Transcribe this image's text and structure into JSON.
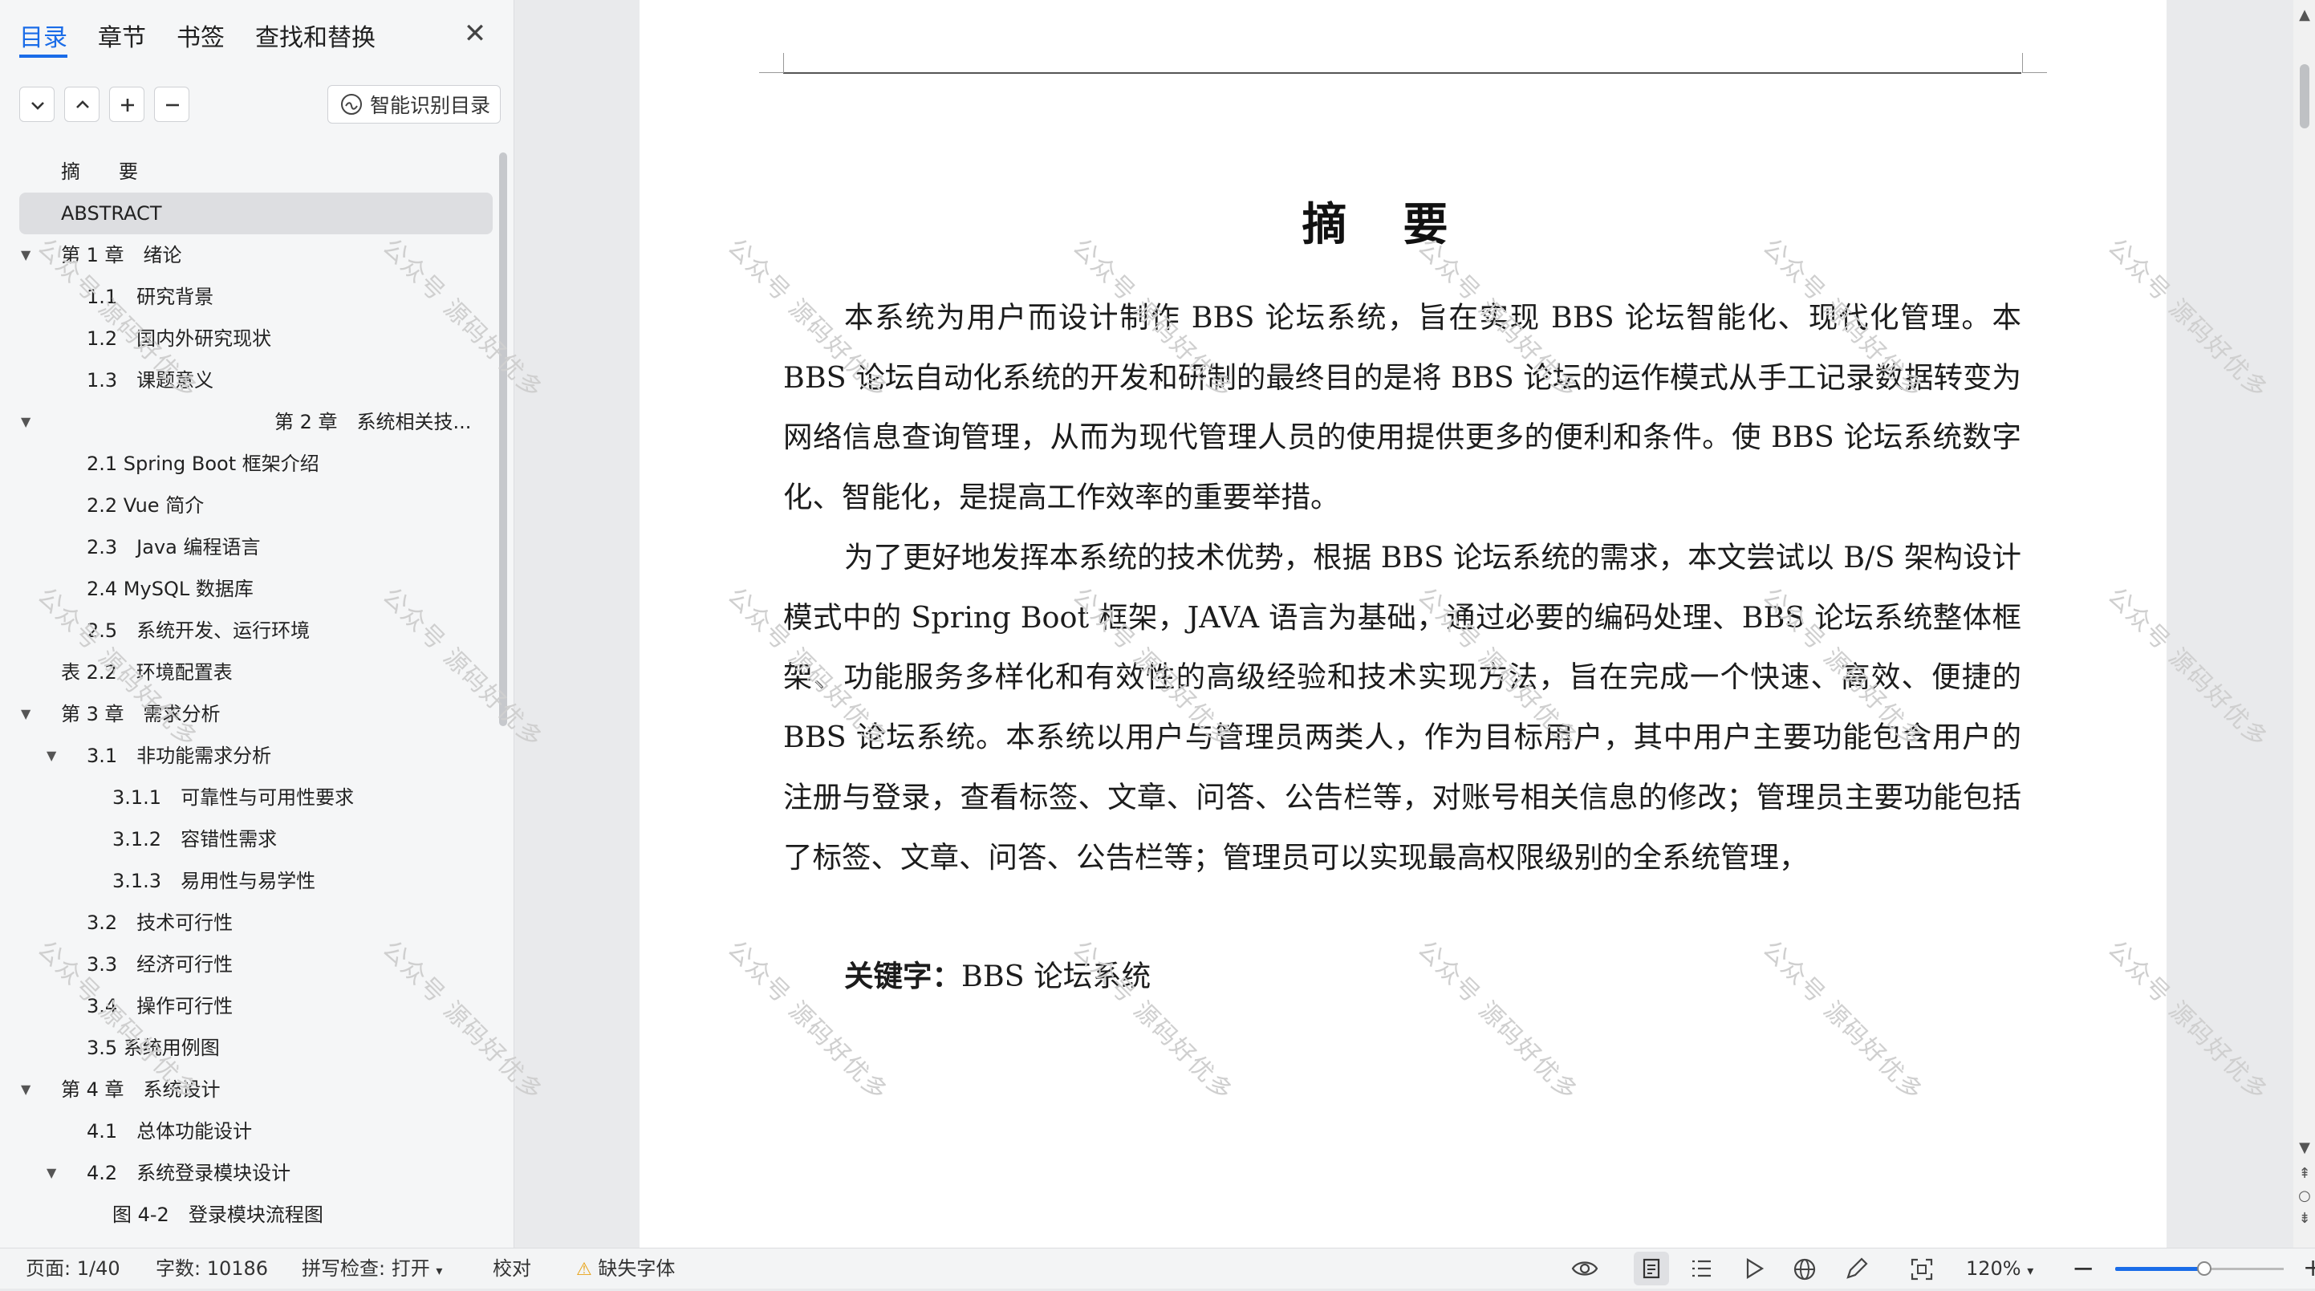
{
  "nav": {
    "tabs": [
      {
        "label": "目录",
        "active": true
      },
      {
        "label": "章节",
        "active": false
      },
      {
        "label": "书签",
        "active": false
      },
      {
        "label": "查找和替换",
        "active": false
      }
    ],
    "close_icon": "close-icon",
    "smart_button_label": "智能识别目录",
    "toc": [
      {
        "label": "摘　　要",
        "level": 1,
        "arrow": ""
      },
      {
        "label": "ABSTRACT",
        "level": 1,
        "arrow": "",
        "selected": true
      },
      {
        "label": "第 1 章　绪论",
        "level": 1,
        "arrow": "▼"
      },
      {
        "label": "1.1　研究背景",
        "level": 2,
        "arrow": ""
      },
      {
        "label": "1.2　国内外研究现状",
        "level": 2,
        "arrow": ""
      },
      {
        "label": "1.3　课题意义",
        "level": 2,
        "arrow": ""
      },
      {
        "label": "第 2 章　系统相关技...",
        "level": 0,
        "arrow": "▼"
      },
      {
        "label": "2.1 Spring Boot 框架介绍",
        "level": 2,
        "arrow": ""
      },
      {
        "label": "2.2 Vue 简介",
        "level": 2,
        "arrow": ""
      },
      {
        "label": "2.3　Java 编程语言",
        "level": 2,
        "arrow": ""
      },
      {
        "label": "2.4 MySQL 数据库",
        "level": 2,
        "arrow": ""
      },
      {
        "label": "2.5　系统开发、运行环境",
        "level": 2,
        "arrow": ""
      },
      {
        "label": "表 2.2　环境配置表",
        "level": 1,
        "arrow": ""
      },
      {
        "label": "第 3 章　需求分析",
        "level": 1,
        "arrow": "▼"
      },
      {
        "label": "3.1　非功能需求分析",
        "level": 2,
        "arrow": "▼"
      },
      {
        "label": "3.1.1　可靠性与可用性要求",
        "level": 3,
        "arrow": ""
      },
      {
        "label": "3.1.2　容错性需求",
        "level": 3,
        "arrow": ""
      },
      {
        "label": "3.1.3　易用性与易学性",
        "level": 3,
        "arrow": ""
      },
      {
        "label": "3.2　技术可行性",
        "level": 2,
        "arrow": ""
      },
      {
        "label": "3.3　经济可行性",
        "level": 2,
        "arrow": ""
      },
      {
        "label": "3.4　操作可行性",
        "level": 2,
        "arrow": ""
      },
      {
        "label": "3.5 系统用例图",
        "level": 2,
        "arrow": ""
      },
      {
        "label": "第 4 章　系统设计",
        "level": 1,
        "arrow": "▼"
      },
      {
        "label": "4.1　总体功能设计",
        "level": 2,
        "arrow": ""
      },
      {
        "label": "4.2　系统登录模块设计",
        "level": 2,
        "arrow": "▼"
      },
      {
        "label": "图 4-2　登录模块流程图",
        "level": 3,
        "arrow": ""
      }
    ]
  },
  "document": {
    "title": "摘要",
    "paragraphs": [
      "本系统为用户而设计制作 BBS 论坛系统，旨在实现 BBS 论坛智能化、现代化管理。本 BBS 论坛自动化系统的开发和研制的最终目的是将 BBS 论坛的运作模式从手工记录数据转变为网络信息查询管理，从而为现代管理人员的使用提供更多的便利和条件。使 BBS 论坛系统数字化、智能化，是提高工作效率的重要举措。",
      "为了更好地发挥本系统的技术优势，根据 BBS 论坛系统的需求，本文尝试以 B/S 架构设计模式中的 Spring Boot 框架，JAVA 语言为基础，通过必要的编码处理、BBS 论坛系统整体框架、功能服务多样化和有效性的高级经验和技术实现方法，旨在完成一个快速、高效、便捷的 BBS 论坛系统。本系统以用户与管理员两类人，作为目标用户，其中用户主要功能包含用户的注册与登录，查看标签、文章、问答、公告栏等，对账号相关信息的修改；管理员主要功能包括了标签、文章、问答、公告栏等；管理员可以实现最高权限级别的全系统管理，"
    ],
    "keywords_label": "关键字：",
    "keywords_value": "BBS 论坛系统",
    "watermark": "公众号 源码好优多"
  },
  "status": {
    "page": "页面: 1/40",
    "word_count": "字数: 10186",
    "spell_check": "拼写检查: 打开",
    "proofread": "校对",
    "missing_font": "缺失字体",
    "zoom": "120%",
    "zoom_slider_fraction": 0.53
  }
}
